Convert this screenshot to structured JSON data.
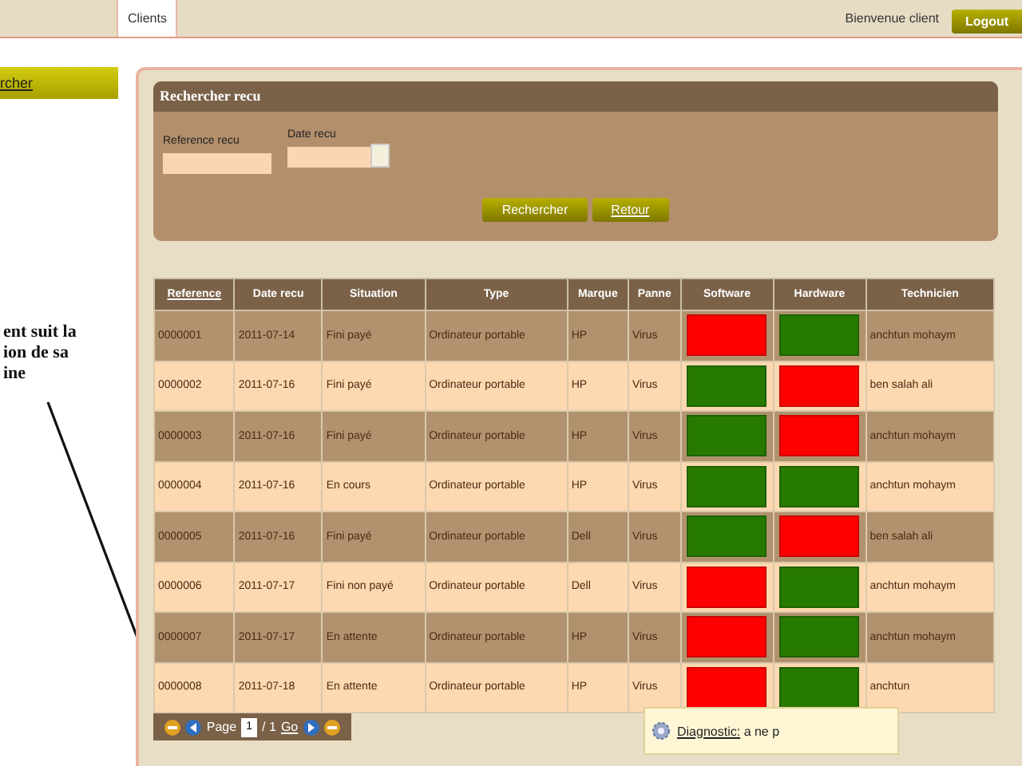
{
  "top_bar": {
    "tabs": [
      {
        "label": "Clients",
        "selected": true
      }
    ],
    "welcome": "Bienvenue client",
    "logout": "Logout"
  },
  "sidebar": {
    "items": [
      {
        "label": "rcher",
        "selected": true
      }
    ]
  },
  "annotation": {
    "lines": [
      "ent suit la",
      "ion de sa",
      "ine"
    ]
  },
  "search_panel": {
    "title": "Rechercher recu",
    "fields": [
      {
        "label": "Reference recu",
        "kind": "text"
      },
      {
        "label": "Date recu",
        "kind": "date"
      }
    ],
    "buttons": [
      "Rechercher",
      "Retour"
    ]
  },
  "table": {
    "columns": [
      "Reference",
      "Date recu",
      "Situation",
      "Type",
      "Marque",
      "Panne",
      "Software",
      "Hardware",
      "Technicien"
    ],
    "rows": [
      {
        "reference": "0000001",
        "date": "2011-07-14",
        "situation": "Fini payé",
        "type": "Ordinateur portable",
        "marque": "HP",
        "panne": "Virus",
        "software": {
          "color": "#ff0000"
        },
        "hardware": {
          "color": "#267a00"
        },
        "technicien": "anchtun mohaym"
      },
      {
        "reference": "0000002",
        "date": "2011-07-16",
        "situation": "Fini payé",
        "type": "Ordinateur portable",
        "marque": "HP",
        "panne": "Virus",
        "software": {
          "color": "#267a00"
        },
        "hardware": {
          "color": "#ff0000"
        },
        "technicien": "ben salah ali"
      },
      {
        "reference": "0000003",
        "date": "2011-07-16",
        "situation": "Fini payé",
        "type": "Ordinateur portable",
        "marque": "HP",
        "panne": "Virus",
        "software": {
          "color": "#267a00"
        },
        "hardware": {
          "color": "#ff0000"
        },
        "technicien": "anchtun mohaym"
      },
      {
        "reference": "0000004",
        "date": "2011-07-16",
        "situation": "En cours",
        "type": "Ordinateur portable",
        "marque": "HP",
        "panne": "Virus",
        "software": {
          "color": "#267a00"
        },
        "hardware": {
          "color": "#267a00"
        },
        "technicien": "anchtun mohaym"
      },
      {
        "reference": "0000005",
        "date": "2011-07-16",
        "situation": "Fini payé",
        "type": "Ordinateur portable",
        "marque": "Dell",
        "panne": "Virus",
        "software": {
          "color": "#267a00"
        },
        "hardware": {
          "color": "#ff0000"
        },
        "technicien": "ben salah ali"
      },
      {
        "reference": "0000006",
        "date": "2011-07-17",
        "situation": "Fini non payé",
        "type": "Ordinateur portable",
        "marque": "Dell",
        "panne": "Virus",
        "software": {
          "color": "#ff0000"
        },
        "hardware": {
          "color": "#267a00"
        },
        "technicien": "anchtun mohaym"
      },
      {
        "reference": "0000007",
        "date": "2011-07-17",
        "situation": "En attente",
        "type": "Ordinateur portable",
        "marque": "HP",
        "panne": "Virus",
        "software": {
          "color": "#ff0000"
        },
        "hardware": {
          "color": "#267a00"
        },
        "technicien": "anchtun mohaym"
      },
      {
        "reference": "0000008",
        "date": "2011-07-18",
        "situation": "En attente",
        "type": "Ordinateur portable",
        "marque": "HP",
        "panne": "Virus",
        "software": {
          "color": "#ff0000"
        },
        "hardware": {
          "color": "#267a00"
        },
        "technicien": "anchtun"
      }
    ]
  },
  "pagination": {
    "label": "Page",
    "page": "1",
    "total": "/ 1",
    "go": "Go"
  },
  "tooltip": {
    "label": "Diagnostic:",
    "text": "a ne p"
  }
}
